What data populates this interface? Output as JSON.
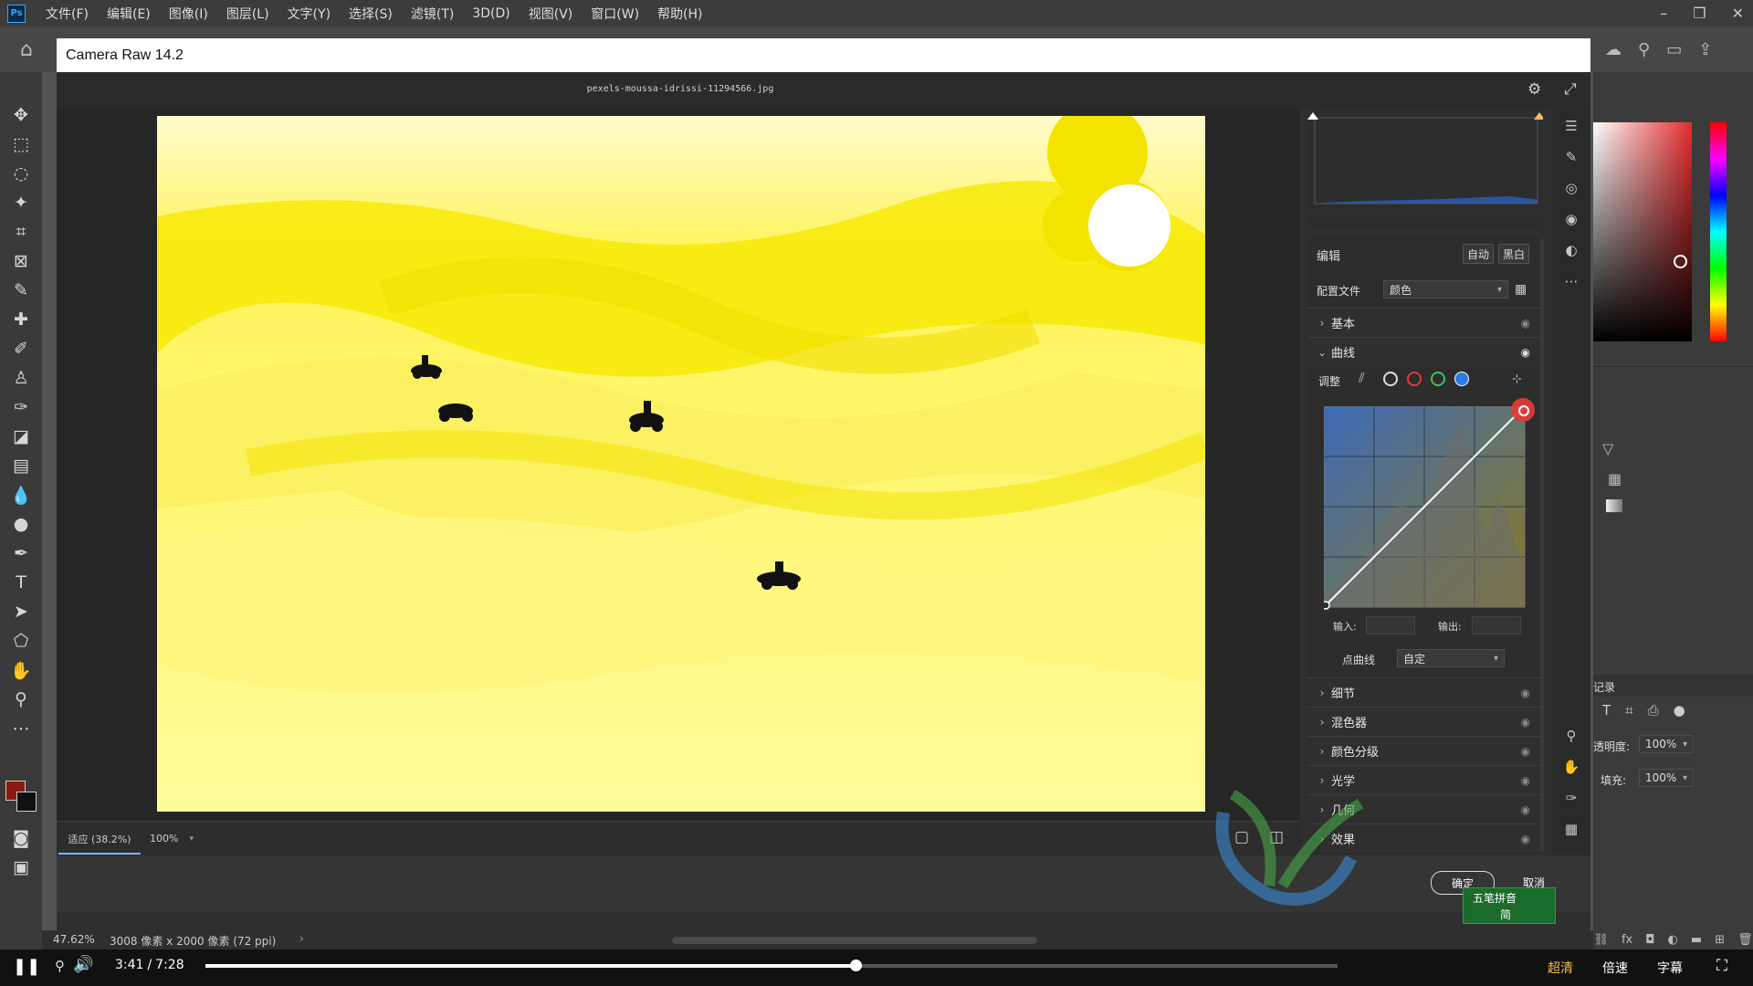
{
  "menubar": {
    "logo": "Ps",
    "items": [
      "文件(F)",
      "编辑(E)",
      "图像(I)",
      "图层(L)",
      "文字(Y)",
      "选择(S)",
      "滤镜(T)",
      "3D(D)",
      "视图(V)",
      "窗口(W)",
      "帮助(H)"
    ]
  },
  "camera_raw": {
    "title": "Camera Raw 14.2",
    "filename": "pexels-moussa-idrissi-11294566.jpg",
    "zoom_fit": "适应 (38.2%)",
    "zoom_100": "100%",
    "ok_label": "确定",
    "cancel_label": "取消"
  },
  "edit_panel": {
    "header": "编辑",
    "auto_label": "自动",
    "bw_label": "黑白",
    "profile_label": "配置文件",
    "profile_value": "颜色",
    "sections_top": [
      {
        "label": "基本"
      }
    ],
    "curves": {
      "label": "曲线",
      "adjust_label": "调整",
      "input_label": "输入:",
      "output_label": "输出:",
      "point_curve_label": "点曲线",
      "point_curve_value": "自定"
    },
    "sections_bottom": [
      {
        "label": "细节"
      },
      {
        "label": "混色器"
      },
      {
        "label": "颜色分级"
      },
      {
        "label": "光学"
      },
      {
        "label": "几何"
      },
      {
        "label": "效果"
      }
    ]
  },
  "right_panels": {
    "history_label": "记录",
    "opacity_label": "透明度:",
    "opacity_value": "100%",
    "fill_label": "填充:",
    "fill_value": "100%"
  },
  "status": {
    "zoom": "47.62%",
    "doc_info": "3008 像素 x 2000 像素 (72 ppi)"
  },
  "video": {
    "current_time": "3:41",
    "separator": "/",
    "total_time": "7:28",
    "progress": 0.574,
    "quality_label": "超清",
    "speed_label": "倍速",
    "subtitle_label": "字幕"
  },
  "ime": {
    "label": "五笔拼音",
    "mode": "简"
  },
  "colors": {
    "photo_bg": "#f7f000",
    "accent_red": "#e03a3a",
    "ps_blue": "#31a8ff"
  }
}
